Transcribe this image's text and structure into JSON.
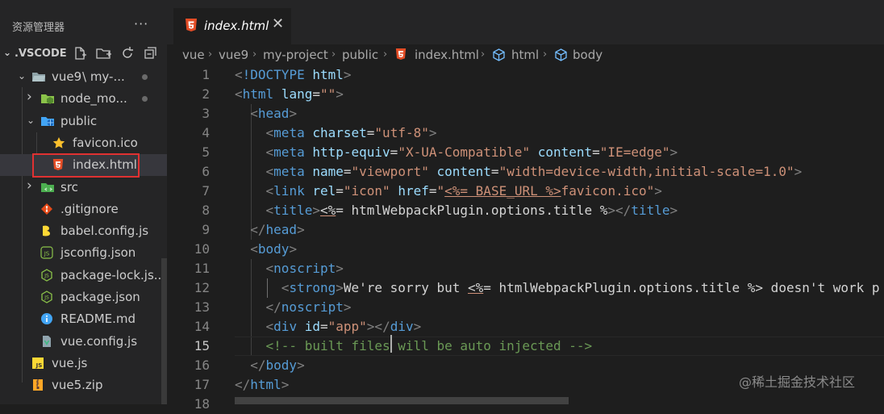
{
  "sidebar": {
    "title": "资源管理器",
    "more": "···",
    "root_label": ".VSCODE",
    "tree": [
      {
        "name": "vue9",
        "suffix": "\\ my-...",
        "icon": "folder-open-icon",
        "indent": 1,
        "twisty": "open",
        "dot": true
      },
      {
        "name": "node_mo...",
        "icon": "node-modules-folder-icon",
        "indent": 2,
        "twisty": "closed",
        "dot": true
      },
      {
        "name": "public",
        "icon": "globe-folder-icon",
        "indent": 2,
        "twisty": "open"
      },
      {
        "name": "favicon.ico",
        "icon": "star-icon",
        "indent": 3
      },
      {
        "name": "index.html",
        "icon": "html5-icon",
        "indent": 3,
        "selected": true
      },
      {
        "name": "src",
        "icon": "src-folder-icon",
        "indent": 2,
        "twisty": "closed"
      },
      {
        "name": ".gitignore",
        "icon": "git-icon",
        "indent": 2
      },
      {
        "name": "babel.config.js",
        "icon": "babel-icon",
        "indent": 2
      },
      {
        "name": "jsconfig.json",
        "icon": "json-icon",
        "indent": 2
      },
      {
        "name": "package-lock.js...",
        "icon": "nodejs-icon",
        "indent": 2
      },
      {
        "name": "package.json",
        "icon": "nodejs-icon",
        "indent": 2
      },
      {
        "name": "README.md",
        "icon": "info-icon",
        "indent": 2
      },
      {
        "name": "vue.config.js",
        "icon": "vue-config-icon",
        "indent": 2
      },
      {
        "name": "vue.js",
        "icon": "js-icon",
        "indent": 1
      },
      {
        "name": "vue5.zip",
        "icon": "zip-icon",
        "indent": 1
      }
    ]
  },
  "tab": {
    "name": "index.html",
    "close": "✕",
    "icon": "html5-icon"
  },
  "breadcrumb": [
    "vue",
    "vue9",
    "my-project",
    "public",
    "index.html",
    "html",
    "body"
  ],
  "editor": {
    "lines": [
      {
        "n": "1",
        "tokens": [
          [
            "t-punc",
            "<"
          ],
          [
            "t-tag",
            "!DOCTYPE"
          ],
          [
            "t-text",
            " "
          ],
          [
            "t-attr",
            "html"
          ],
          [
            "t-punc",
            ">"
          ]
        ]
      },
      {
        "n": "2",
        "tokens": [
          [
            "t-punc",
            "<"
          ],
          [
            "t-tag",
            "html"
          ],
          [
            "t-text",
            " "
          ],
          [
            "t-attr",
            "lang"
          ],
          [
            "t-text",
            "="
          ],
          [
            "t-str",
            "\"\""
          ],
          [
            "t-punc",
            ">"
          ]
        ]
      },
      {
        "n": "3",
        "tokens": [
          [
            "t-text",
            "  "
          ],
          [
            "t-punc",
            "<"
          ],
          [
            "t-tag",
            "head"
          ],
          [
            "t-punc",
            ">"
          ]
        ]
      },
      {
        "n": "4",
        "tokens": [
          [
            "t-text",
            "    "
          ],
          [
            "t-punc",
            "<"
          ],
          [
            "t-tag",
            "meta"
          ],
          [
            "t-text",
            " "
          ],
          [
            "t-attr",
            "charset"
          ],
          [
            "t-text",
            "="
          ],
          [
            "t-str",
            "\"utf-8\""
          ],
          [
            "t-punc",
            ">"
          ]
        ]
      },
      {
        "n": "5",
        "tokens": [
          [
            "t-text",
            "    "
          ],
          [
            "t-punc",
            "<"
          ],
          [
            "t-tag",
            "meta"
          ],
          [
            "t-text",
            " "
          ],
          [
            "t-attr",
            "http-equiv"
          ],
          [
            "t-text",
            "="
          ],
          [
            "t-str",
            "\"X-UA-Compatible\""
          ],
          [
            "t-text",
            " "
          ],
          [
            "t-attr",
            "content"
          ],
          [
            "t-text",
            "="
          ],
          [
            "t-str",
            "\"IE=edge\""
          ],
          [
            "t-punc",
            ">"
          ]
        ]
      },
      {
        "n": "6",
        "tokens": [
          [
            "t-text",
            "    "
          ],
          [
            "t-punc",
            "<"
          ],
          [
            "t-tag",
            "meta"
          ],
          [
            "t-text",
            " "
          ],
          [
            "t-attr",
            "name"
          ],
          [
            "t-text",
            "="
          ],
          [
            "t-str",
            "\"viewport\""
          ],
          [
            "t-text",
            " "
          ],
          [
            "t-attr",
            "content"
          ],
          [
            "t-text",
            "="
          ],
          [
            "t-str",
            "\"width=device-width,initial-scale=1.0\""
          ],
          [
            "t-punc",
            ">"
          ]
        ]
      },
      {
        "n": "7",
        "tokens": [
          [
            "t-text",
            "    "
          ],
          [
            "t-punc",
            "<"
          ],
          [
            "t-tag",
            "link"
          ],
          [
            "t-text",
            " "
          ],
          [
            "t-attr",
            "rel"
          ],
          [
            "t-text",
            "="
          ],
          [
            "t-str",
            "\"icon\""
          ],
          [
            "t-text",
            " "
          ],
          [
            "t-attr",
            "href"
          ],
          [
            "t-text",
            "="
          ],
          [
            "t-str",
            "\""
          ],
          [
            "t-strtpl",
            "<%= BASE_URL %>"
          ],
          [
            "t-str",
            "favicon.ico\""
          ],
          [
            "t-punc",
            ">"
          ]
        ]
      },
      {
        "n": "8",
        "tokens": [
          [
            "t-text",
            "    "
          ],
          [
            "t-punc",
            "<"
          ],
          [
            "t-tag",
            "title"
          ],
          [
            "t-punc",
            ">"
          ],
          [
            "t-tplu",
            "<%"
          ],
          [
            "t-tpl",
            "= htmlWebpackPlugin.options.title %"
          ],
          [
            "t-punc",
            "></"
          ],
          [
            "t-tag",
            "title"
          ],
          [
            "t-punc",
            ">"
          ]
        ]
      },
      {
        "n": "9",
        "tokens": [
          [
            "t-text",
            "  "
          ],
          [
            "t-punc",
            "</"
          ],
          [
            "t-tag",
            "head"
          ],
          [
            "t-punc",
            ">"
          ]
        ]
      },
      {
        "n": "10",
        "tokens": [
          [
            "t-text",
            "  "
          ],
          [
            "t-punc",
            "<"
          ],
          [
            "t-tag",
            "body"
          ],
          [
            "t-punc",
            ">"
          ]
        ]
      },
      {
        "n": "11",
        "tokens": [
          [
            "t-text",
            "    "
          ],
          [
            "t-punc",
            "<"
          ],
          [
            "t-tag",
            "noscript"
          ],
          [
            "t-punc",
            ">"
          ]
        ]
      },
      {
        "n": "12",
        "tokens": [
          [
            "t-text",
            "      "
          ],
          [
            "t-punc",
            "<"
          ],
          [
            "t-tag",
            "strong"
          ],
          [
            "t-punc",
            ">"
          ],
          [
            "t-text",
            "We're sorry but "
          ],
          [
            "t-tplu",
            "<%"
          ],
          [
            "t-tpl",
            "= htmlWebpackPlugin.options.title %> doesn't work p"
          ]
        ]
      },
      {
        "n": "13",
        "tokens": [
          [
            "t-text",
            "    "
          ],
          [
            "t-punc",
            "</"
          ],
          [
            "t-tag",
            "noscript"
          ],
          [
            "t-punc",
            ">"
          ]
        ]
      },
      {
        "n": "14",
        "tokens": [
          [
            "t-text",
            "    "
          ],
          [
            "t-punc",
            "<"
          ],
          [
            "t-tag",
            "div"
          ],
          [
            "t-text",
            " "
          ],
          [
            "t-attr",
            "id"
          ],
          [
            "t-text",
            "="
          ],
          [
            "t-str",
            "\"app\""
          ],
          [
            "t-punc",
            "></"
          ],
          [
            "t-tag",
            "div"
          ],
          [
            "t-punc",
            ">"
          ]
        ]
      },
      {
        "n": "15",
        "current": true,
        "tokens": [
          [
            "t-text",
            "    "
          ],
          [
            "t-com",
            "<!-- built files will be auto injected -->"
          ]
        ]
      },
      {
        "n": "16",
        "tokens": [
          [
            "t-text",
            "  "
          ],
          [
            "t-punc",
            "</"
          ],
          [
            "t-tag",
            "body"
          ],
          [
            "t-punc",
            ">"
          ]
        ]
      },
      {
        "n": "17",
        "tokens": [
          [
            "t-punc",
            "</"
          ],
          [
            "t-tag",
            "html"
          ],
          [
            "t-punc",
            ">"
          ]
        ]
      },
      {
        "n": "18",
        "tokens": []
      }
    ]
  },
  "watermark": "@稀土掘金技术社区",
  "colors": {
    "accent_html": "#e44d26",
    "selection_box": "#e03131"
  }
}
